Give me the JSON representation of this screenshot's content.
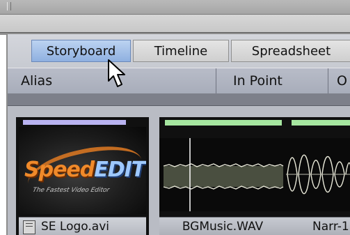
{
  "tabs": [
    {
      "label": "Storyboard",
      "active": true
    },
    {
      "label": "Timeline",
      "active": false
    },
    {
      "label": "Spreadsheet",
      "active": false
    }
  ],
  "columns": [
    "Alias",
    "In Point",
    "O"
  ],
  "clips": [
    {
      "name": "SE Logo.avi",
      "type": "video",
      "icon": "video-file-icon",
      "thumbnail": {
        "title_part1": "Speed",
        "title_part2": "EDIT",
        "tagline": "The Fastest Video Editor"
      },
      "bar_color": "#b9b3f0"
    },
    {
      "name": "BGMusic.WAV",
      "type": "audio",
      "bar_color": "#a6e6a0"
    },
    {
      "name": "Narr-1",
      "type": "audio",
      "bar_color": "#a6e6a0"
    }
  ],
  "colors": {
    "active_tab": "#8fb0e0",
    "panel": "#c5c8d0",
    "header": "#b0b4c0"
  }
}
